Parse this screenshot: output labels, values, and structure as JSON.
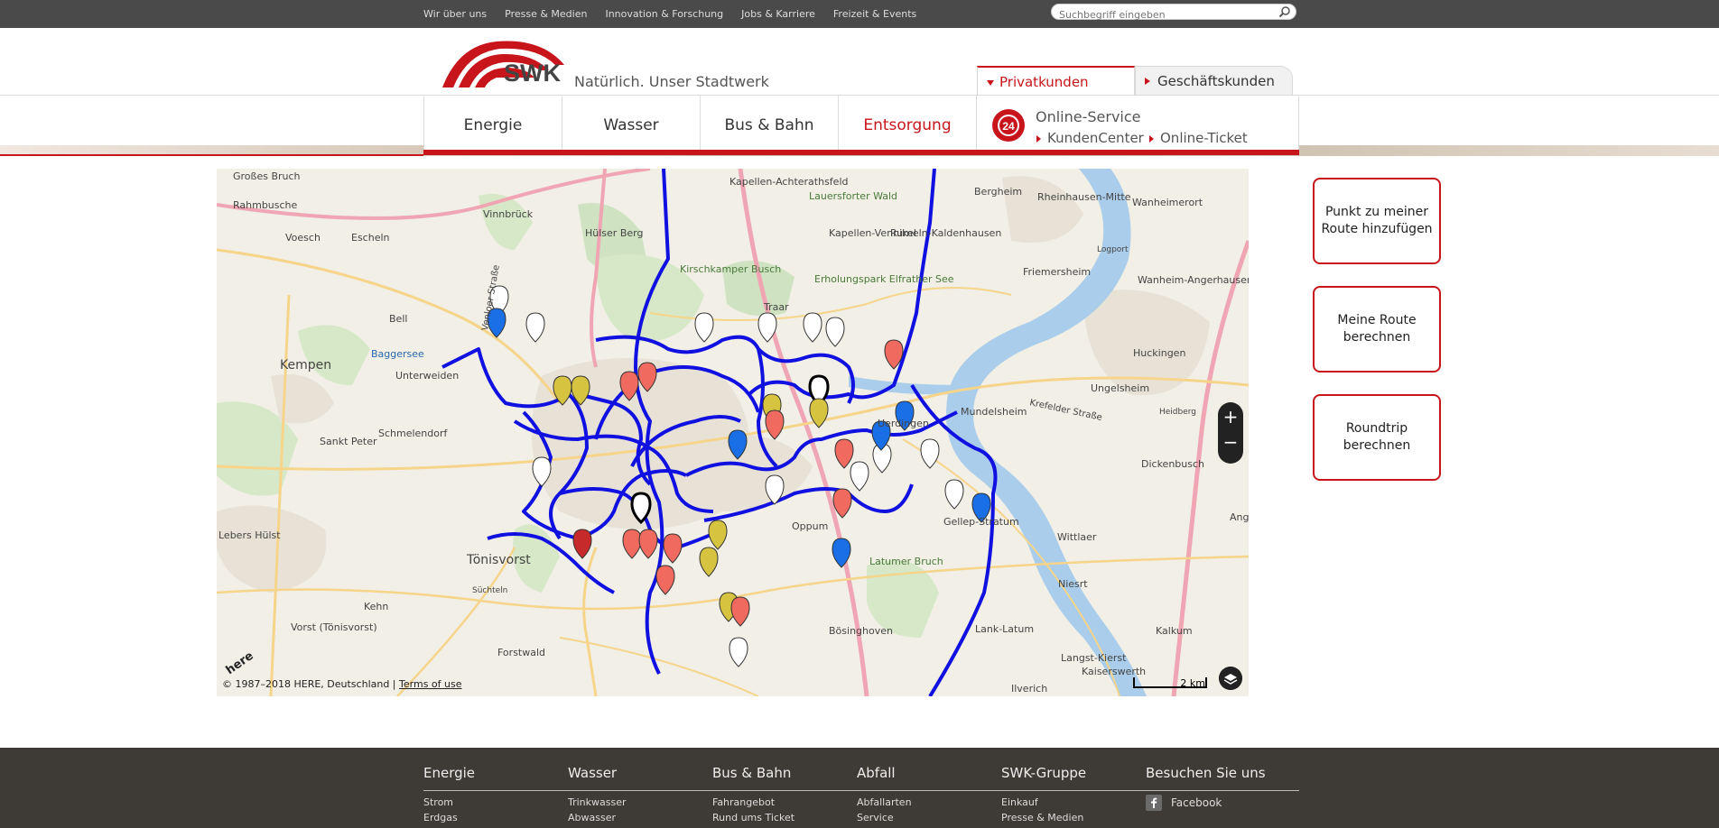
{
  "topnav": [
    "Wir über uns",
    "Presse & Medien",
    "Innovation & Forschung",
    "Jobs & Karriere",
    "Freizeit & Events"
  ],
  "search": {
    "placeholder": "Suchbegriff eingeben"
  },
  "brand": {
    "name": "SWK",
    "tagline": "Natürlich. Unser Stadtwerk",
    "color": "#c8151b"
  },
  "tabs": {
    "privat": "Privatkunden",
    "business": "Geschäftskunden"
  },
  "mainnav": [
    "Energie",
    "Wasser",
    "Bus & Bahn",
    "Entsorgung"
  ],
  "online": {
    "title": "Online-Service",
    "badge": "24",
    "kundencenter": "KundenCenter",
    "ticket": "Online-Ticket"
  },
  "map": {
    "copyright": "© 1987–2018 HERE, Deutschland |",
    "terms": "Terms of use",
    "scale": "2 km",
    "here": "here",
    "labels": [
      {
        "t": "Großes Bruch"
      },
      {
        "t": "Rahmbusche"
      },
      {
        "t": "Vinnbrück"
      },
      {
        "t": "Voesch"
      },
      {
        "t": "Escheln"
      },
      {
        "t": "Hülser Berg"
      },
      {
        "t": "Kapellen-Achterathsfeld"
      },
      {
        "t": "Lauersforter Wald"
      },
      {
        "t": "Kapellen-Vennikel"
      },
      {
        "t": "Rumeln-Kaldenhausen"
      },
      {
        "t": "Bergheim"
      },
      {
        "t": "Rheinhausen-Mitte"
      },
      {
        "t": "Wanheimerort"
      },
      {
        "t": "Friemersheim"
      },
      {
        "t": "Wanheim-Angerhausen"
      },
      {
        "t": "Kempen"
      },
      {
        "t": "Bell"
      },
      {
        "t": "Unterweiden"
      },
      {
        "t": "Baggersee"
      },
      {
        "t": "Kirschkamper Busch"
      },
      {
        "t": "Erholungspark Elfrather See"
      },
      {
        "t": "Traar"
      },
      {
        "t": "Huckingen"
      },
      {
        "t": "Ungelsheim"
      },
      {
        "t": "Mundelsheim"
      },
      {
        "t": "Sankt Peter"
      },
      {
        "t": "Schmelendorf"
      },
      {
        "t": "Uerdingen"
      },
      {
        "t": "Tönisvorst"
      },
      {
        "t": "Kehn"
      },
      {
        "t": "Vorst (Tönisvorst)"
      },
      {
        "t": "Forstwald"
      },
      {
        "t": "Oppum"
      },
      {
        "t": "Bösinghoven"
      },
      {
        "t": "Latumer Bruch"
      },
      {
        "t": "Gellep-Stratum"
      },
      {
        "t": "Wittlaer"
      },
      {
        "t": "Lank-Latum"
      },
      {
        "t": "Niesrt"
      },
      {
        "t": "Kalkum"
      },
      {
        "t": "Kaiserswerth"
      },
      {
        "t": "Langst-Kierst"
      },
      {
        "t": "Ilverich"
      },
      {
        "t": "Lebers Hülst"
      },
      {
        "t": "Süchteln"
      },
      {
        "t": "Krefelder Straße"
      },
      {
        "t": "Venloer Straße"
      },
      {
        "t": "Dickenbusch"
      },
      {
        "t": "Angermund"
      },
      {
        "t": "Heidberg"
      },
      {
        "t": "Logport"
      }
    ]
  },
  "side_buttons": [
    "Punkt zu meiner Route hinzufügen",
    "Meine Route berechnen",
    "Roundtrip berechnen"
  ],
  "footer": [
    {
      "h": "Energie",
      "links": [
        "Strom",
        "Erdgas"
      ]
    },
    {
      "h": "Wasser",
      "links": [
        "Trinkwasser",
        "Abwasser"
      ]
    },
    {
      "h": "Bus & Bahn",
      "links": [
        "Fahrangebot",
        "Rund ums Ticket"
      ]
    },
    {
      "h": "Abfall",
      "links": [
        "Abfallarten",
        "Service"
      ]
    },
    {
      "h": "SWK-Gruppe",
      "links": [
        "Einkauf",
        "Presse & Medien"
      ]
    },
    {
      "h": "Besuchen Sie uns",
      "links": [
        "Facebook"
      ]
    }
  ]
}
